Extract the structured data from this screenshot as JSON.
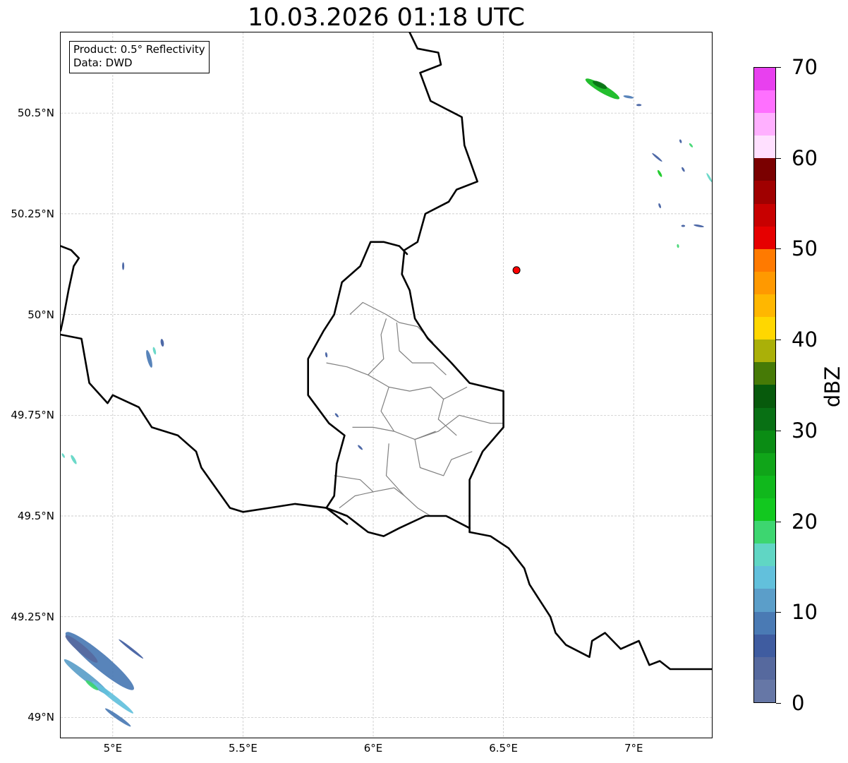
{
  "title": "10.03.2026 01:18 UTC",
  "info_box": {
    "product": "Product: 0.5° Reflectivity",
    "data_source": "Data: DWD"
  },
  "map": {
    "type": "radar-reflectivity-map",
    "extent": {
      "lon": [
        4.8,
        7.3
      ],
      "lat": [
        48.95,
        50.7
      ]
    },
    "gridlines": true,
    "lat_ticks": [
      {
        "value": 50.5,
        "label": "50.5°N"
      },
      {
        "value": 50.25,
        "label": "50.25°N"
      },
      {
        "value": 50.0,
        "label": "50°N"
      },
      {
        "value": 49.75,
        "label": "49.75°N"
      },
      {
        "value": 49.5,
        "label": "49.5°N"
      },
      {
        "value": 49.25,
        "label": "49.25°N"
      },
      {
        "value": 49.0,
        "label": "49°N"
      }
    ],
    "lon_ticks": [
      {
        "value": 5.0,
        "label": "5°E"
      },
      {
        "value": 5.5,
        "label": "5.5°E"
      },
      {
        "value": 6.0,
        "label": "6°E"
      },
      {
        "value": 6.5,
        "label": "6.5°E"
      },
      {
        "value": 7.0,
        "label": "7°E"
      }
    ],
    "radar_site": {
      "lon": 6.55,
      "lat": 50.11,
      "color": "#ff0000"
    },
    "border_color": "#000000",
    "district_color": "#808080",
    "borders": {
      "luxembourg_de": [
        [
          6.14,
          50.7
        ],
        [
          6.17,
          50.66
        ],
        [
          6.25,
          50.65
        ],
        [
          6.26,
          50.62
        ],
        [
          6.18,
          50.6
        ],
        [
          6.22,
          50.53
        ],
        [
          6.34,
          50.49
        ],
        [
          6.35,
          50.42
        ],
        [
          6.4,
          50.33
        ],
        [
          6.32,
          50.31
        ],
        [
          6.29,
          50.28
        ],
        [
          6.2,
          50.25
        ],
        [
          6.17,
          50.18
        ],
        [
          6.12,
          50.16
        ],
        [
          6.11,
          50.1
        ],
        [
          6.14,
          50.06
        ],
        [
          6.16,
          49.99
        ],
        [
          6.21,
          49.94
        ],
        [
          6.3,
          49.88
        ],
        [
          6.37,
          49.83
        ],
        [
          6.5,
          49.81
        ],
        [
          6.5,
          49.72
        ],
        [
          6.42,
          49.66
        ],
        [
          6.37,
          49.59
        ],
        [
          6.37,
          49.46
        ]
      ],
      "luxembourg_be": [
        [
          6.13,
          50.15
        ],
        [
          6.1,
          50.17
        ],
        [
          6.04,
          50.18
        ],
        [
          5.99,
          50.18
        ],
        [
          5.95,
          50.12
        ],
        [
          5.88,
          50.08
        ],
        [
          5.85,
          50.0
        ],
        [
          5.81,
          49.96
        ],
        [
          5.75,
          49.89
        ],
        [
          5.75,
          49.8
        ],
        [
          5.83,
          49.73
        ],
        [
          5.89,
          49.7
        ],
        [
          5.86,
          49.63
        ],
        [
          5.85,
          49.55
        ],
        [
          5.82,
          49.52
        ],
        [
          5.9,
          49.48
        ]
      ],
      "luxembourg_fr": [
        [
          5.82,
          49.52
        ],
        [
          5.9,
          49.5
        ],
        [
          5.98,
          49.46
        ],
        [
          6.04,
          49.45
        ],
        [
          6.1,
          49.47
        ],
        [
          6.2,
          49.5
        ],
        [
          6.28,
          49.5
        ],
        [
          6.37,
          49.47
        ]
      ],
      "belgium_fr": [
        [
          4.8,
          49.95
        ],
        [
          4.88,
          49.94
        ],
        [
          4.91,
          49.83
        ],
        [
          4.98,
          49.78
        ],
        [
          5.0,
          49.8
        ],
        [
          5.1,
          49.77
        ],
        [
          5.15,
          49.72
        ],
        [
          5.25,
          49.7
        ],
        [
          5.32,
          49.66
        ],
        [
          5.34,
          49.62
        ],
        [
          5.45,
          49.52
        ],
        [
          5.5,
          49.51
        ],
        [
          5.6,
          49.52
        ],
        [
          5.7,
          49.53
        ],
        [
          5.82,
          49.52
        ]
      ],
      "belgium_nl": [
        [
          4.8,
          50.17
        ],
        [
          4.84,
          50.16
        ],
        [
          4.87,
          50.14
        ],
        [
          4.85,
          50.12
        ],
        [
          4.83,
          50.06
        ],
        [
          4.81,
          49.99
        ],
        [
          4.8,
          49.96
        ]
      ],
      "germany_fr": [
        [
          6.37,
          49.46
        ],
        [
          6.45,
          49.45
        ],
        [
          6.52,
          49.42
        ],
        [
          6.58,
          49.37
        ],
        [
          6.6,
          49.33
        ],
        [
          6.65,
          49.28
        ],
        [
          6.68,
          49.25
        ],
        [
          6.7,
          49.21
        ],
        [
          6.74,
          49.18
        ],
        [
          6.83,
          49.15
        ],
        [
          6.84,
          49.19
        ],
        [
          6.89,
          49.21
        ],
        [
          6.95,
          49.17
        ],
        [
          7.02,
          49.19
        ],
        [
          7.06,
          49.13
        ],
        [
          7.1,
          49.14
        ],
        [
          7.14,
          49.12
        ],
        [
          7.3,
          49.12
        ]
      ]
    },
    "districts": [
      [
        [
          5.91,
          50.0
        ],
        [
          5.96,
          50.03
        ],
        [
          6.05,
          50.0
        ],
        [
          6.1,
          49.98
        ],
        [
          6.17,
          49.97
        ],
        [
          6.23,
          49.93
        ]
      ],
      [
        [
          6.05,
          49.99
        ],
        [
          6.03,
          49.95
        ],
        [
          6.04,
          49.89
        ],
        [
          5.98,
          49.85
        ],
        [
          5.9,
          49.87
        ],
        [
          5.82,
          49.88
        ]
      ],
      [
        [
          6.09,
          49.98
        ],
        [
          6.1,
          49.91
        ],
        [
          6.15,
          49.88
        ],
        [
          6.23,
          49.88
        ],
        [
          6.28,
          49.85
        ]
      ],
      [
        [
          5.98,
          49.85
        ],
        [
          6.06,
          49.82
        ],
        [
          6.14,
          49.81
        ],
        [
          6.22,
          49.82
        ],
        [
          6.27,
          49.79
        ],
        [
          6.36,
          49.82
        ]
      ],
      [
        [
          6.06,
          49.82
        ],
        [
          6.03,
          49.76
        ],
        [
          6.08,
          49.71
        ],
        [
          6.16,
          49.69
        ],
        [
          6.25,
          49.71
        ],
        [
          6.33,
          49.75
        ],
        [
          6.45,
          49.73
        ],
        [
          6.5,
          49.73
        ]
      ],
      [
        [
          5.92,
          49.72
        ],
        [
          6.0,
          49.72
        ],
        [
          6.08,
          49.71
        ]
      ],
      [
        [
          6.06,
          49.68
        ],
        [
          6.05,
          49.6
        ],
        [
          6.12,
          49.55
        ],
        [
          6.17,
          49.52
        ],
        [
          6.22,
          49.5
        ],
        [
          6.25,
          49.5
        ]
      ],
      [
        [
          6.16,
          49.69
        ],
        [
          6.18,
          49.62
        ],
        [
          6.27,
          49.6
        ],
        [
          6.3,
          49.64
        ],
        [
          6.38,
          49.66
        ]
      ],
      [
        [
          5.85,
          49.6
        ],
        [
          5.95,
          49.59
        ],
        [
          6.0,
          49.56
        ],
        [
          6.08,
          49.57
        ],
        [
          6.12,
          49.55
        ]
      ],
      [
        [
          5.87,
          49.52
        ],
        [
          5.93,
          49.55
        ],
        [
          6.0,
          49.56
        ]
      ],
      [
        [
          6.16,
          49.69
        ],
        [
          6.24,
          49.71
        ]
      ],
      [
        [
          6.27,
          49.79
        ],
        [
          6.25,
          49.74
        ],
        [
          6.32,
          49.7
        ]
      ]
    ],
    "echoes": [
      {
        "lon": 4.95,
        "lat": 49.14,
        "l": 0.34,
        "w": 0.06,
        "a": -40,
        "dbz": 8
      },
      {
        "lon": 4.9,
        "lat": 49.1,
        "l": 0.22,
        "w": 0.03,
        "a": -38,
        "dbz": 12
      },
      {
        "lon": 5.0,
        "lat": 49.05,
        "l": 0.2,
        "w": 0.02,
        "a": -38,
        "dbz": 14
      },
      {
        "lon": 4.88,
        "lat": 49.17,
        "l": 0.16,
        "w": 0.03,
        "a": -40,
        "dbz": 4
      },
      {
        "lon": 4.92,
        "lat": 49.08,
        "l": 0.06,
        "w": 0.015,
        "a": -38,
        "dbz": 19
      },
      {
        "lon": 5.02,
        "lat": 49.0,
        "l": 0.12,
        "w": 0.015,
        "a": -35,
        "dbz": 9
      },
      {
        "lon": 5.07,
        "lat": 49.17,
        "l": 0.12,
        "w": 0.01,
        "a": -38,
        "dbz": 6
      },
      {
        "lon": 5.14,
        "lat": 49.89,
        "l": 0.07,
        "w": 0.016,
        "a": -75,
        "dbz": 8
      },
      {
        "lon": 5.16,
        "lat": 49.91,
        "l": 0.03,
        "w": 0.01,
        "a": -75,
        "dbz": 15
      },
      {
        "lon": 5.19,
        "lat": 49.93,
        "l": 0.03,
        "w": 0.012,
        "a": -80,
        "dbz": 5
      },
      {
        "lon": 5.04,
        "lat": 50.12,
        "l": 0.03,
        "w": 0.008,
        "a": -90,
        "dbz": 6
      },
      {
        "lon": 4.85,
        "lat": 49.64,
        "l": 0.04,
        "w": 0.012,
        "a": -60,
        "dbz": 16
      },
      {
        "lon": 4.81,
        "lat": 49.65,
        "l": 0.02,
        "w": 0.008,
        "a": -60,
        "dbz": 17
      },
      {
        "lon": 6.88,
        "lat": 50.56,
        "l": 0.15,
        "w": 0.03,
        "a": -30,
        "dbz": 24
      },
      {
        "lon": 6.87,
        "lat": 50.57,
        "l": 0.06,
        "w": 0.02,
        "a": -25,
        "dbz": 30
      },
      {
        "lon": 6.98,
        "lat": 50.54,
        "l": 0.04,
        "w": 0.01,
        "a": -10,
        "dbz": 8
      },
      {
        "lon": 7.02,
        "lat": 50.52,
        "l": 0.02,
        "w": 0.007,
        "a": 0,
        "dbz": 6
      },
      {
        "lon": 7.09,
        "lat": 50.39,
        "l": 0.05,
        "w": 0.008,
        "a": -40,
        "dbz": 7
      },
      {
        "lon": 7.1,
        "lat": 50.35,
        "l": 0.03,
        "w": 0.01,
        "a": -60,
        "dbz": 21
      },
      {
        "lon": 7.22,
        "lat": 50.42,
        "l": 0.02,
        "w": 0.008,
        "a": -50,
        "dbz": 19
      },
      {
        "lon": 7.18,
        "lat": 50.43,
        "l": 0.015,
        "w": 0.006,
        "a": -70,
        "dbz": 6
      },
      {
        "lon": 7.29,
        "lat": 50.34,
        "l": 0.04,
        "w": 0.008,
        "a": -60,
        "dbz": 16
      },
      {
        "lon": 7.19,
        "lat": 50.36,
        "l": 0.02,
        "w": 0.007,
        "a": -60,
        "dbz": 6
      },
      {
        "lon": 7.1,
        "lat": 50.27,
        "l": 0.02,
        "w": 0.007,
        "a": -70,
        "dbz": 6
      },
      {
        "lon": 7.25,
        "lat": 50.22,
        "l": 0.04,
        "w": 0.007,
        "a": -10,
        "dbz": 5
      },
      {
        "lon": 7.19,
        "lat": 50.22,
        "l": 0.015,
        "w": 0.006,
        "a": 0,
        "dbz": 6
      },
      {
        "lon": 7.17,
        "lat": 50.17,
        "l": 0.015,
        "w": 0.006,
        "a": -80,
        "dbz": 18
      },
      {
        "lon": 5.95,
        "lat": 49.67,
        "l": 0.025,
        "w": 0.008,
        "a": -45,
        "dbz": 6
      },
      {
        "lon": 5.82,
        "lat": 49.9,
        "l": 0.02,
        "w": 0.006,
        "a": -80,
        "dbz": 5
      },
      {
        "lon": 5.86,
        "lat": 49.75,
        "l": 0.02,
        "w": 0.006,
        "a": -50,
        "dbz": 6
      }
    ]
  },
  "colorbar": {
    "unit": "dBZ",
    "min": 0,
    "max": 70,
    "step": 2.5,
    "ticks": [
      {
        "value": 0,
        "label": "0"
      },
      {
        "value": 10,
        "label": "10"
      },
      {
        "value": 20,
        "label": "20"
      },
      {
        "value": 30,
        "label": "30"
      },
      {
        "value": 40,
        "label": "40"
      },
      {
        "value": 50,
        "label": "50"
      },
      {
        "value": 60,
        "label": "60"
      },
      {
        "value": 70,
        "label": "70"
      }
    ],
    "colors": [
      "#6677a6",
      "#56699e",
      "#3f5ca0",
      "#4a7ab4",
      "#5b9ec9",
      "#62c0dc",
      "#60d6c4",
      "#3dd670",
      "#12c81f",
      "#10b81c",
      "#10a519",
      "#0a8c14",
      "#087014",
      "#075a0c",
      "#467a06",
      "#aab008",
      "#ffd700",
      "#ffb700",
      "#ff9900",
      "#ff7a00",
      "#e60000",
      "#c80000",
      "#a00000",
      "#7a0000",
      "#ffe0ff",
      "#ffb0ff",
      "#ff70ff",
      "#e840ef"
    ]
  }
}
